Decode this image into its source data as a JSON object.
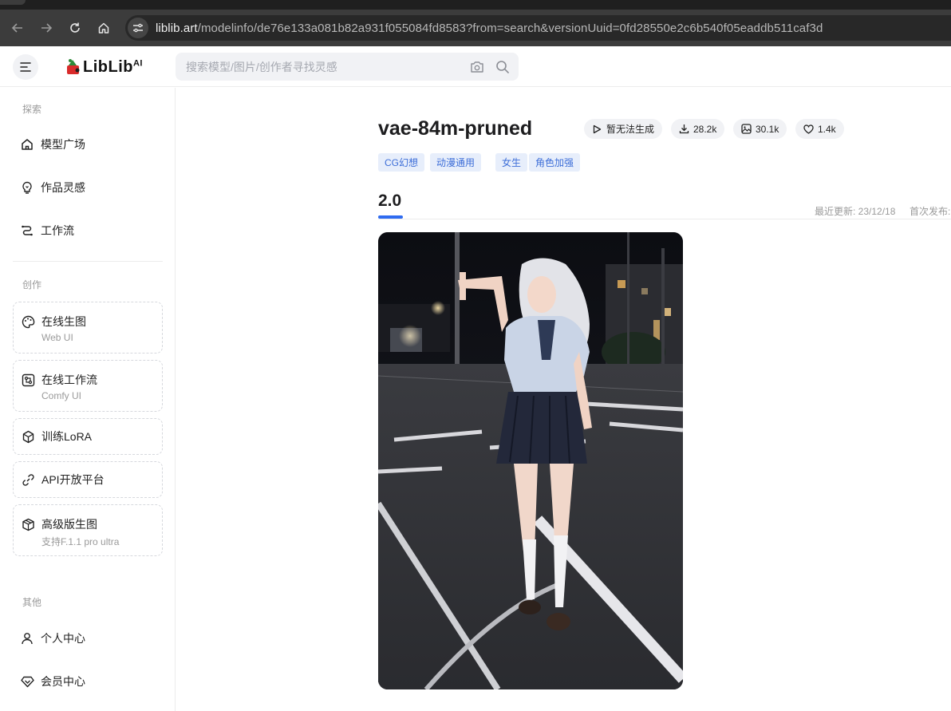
{
  "browser": {
    "url_host": "liblib.art",
    "url_path": "/modelinfo/de76e133a081b82a931f055084fd8583?from=search&versionUuid=0fd28550e2c6b540f05eaddb511caf3d",
    "nav_icons": [
      "back-arrow-icon",
      "forward-arrow-icon",
      "reload-icon",
      "home-icon",
      "site-info-icon"
    ]
  },
  "header": {
    "logo_text": "LibLib",
    "logo_suffix": "AI",
    "search_placeholder": "搜索模型/图片/创作者寻找灵感"
  },
  "sidebar": {
    "explore_label": "探索",
    "explore_items": [
      {
        "label": "模型广场",
        "icon": "home-icon"
      },
      {
        "label": "作品灵感",
        "icon": "lightbulb-icon"
      },
      {
        "label": "工作流",
        "icon": "workflow-icon"
      }
    ],
    "create_label": "创作",
    "create_cards": [
      {
        "title": "在线生图",
        "subtitle": "Web UI",
        "icon": "palette-icon"
      },
      {
        "title": "在线工作流",
        "subtitle": "Comfy UI",
        "icon": "comfy-icon"
      },
      {
        "title": "训练LoRA",
        "subtitle": "",
        "icon": "cube-icon"
      },
      {
        "title": "API开放平台",
        "subtitle": "",
        "icon": "link-icon"
      },
      {
        "title": "高级版生图",
        "subtitle": "支持F.1.1 pro ultra",
        "icon": "box-icon"
      }
    ],
    "other_label": "其他",
    "other_items": [
      {
        "label": "个人中心",
        "icon": "user-icon"
      },
      {
        "label": "会员中心",
        "icon": "diamond-icon"
      }
    ]
  },
  "model": {
    "title": "vae-84m-pruned",
    "generate_label": "暂无法生成",
    "downloads": "28.2k",
    "images": "30.1k",
    "likes": "1.4k",
    "tags": [
      "CG幻想",
      "动漫通用",
      "女生",
      "角色加强"
    ],
    "version": "2.0",
    "updated_label": "最近更新: 23/12/18",
    "published_label": "首次发布:"
  },
  "colors": {
    "accent": "#2f6bf0",
    "tag_bg": "#e7eefb",
    "tag_text": "#3d6ed8",
    "browser_bar": "#3c3c3c"
  }
}
